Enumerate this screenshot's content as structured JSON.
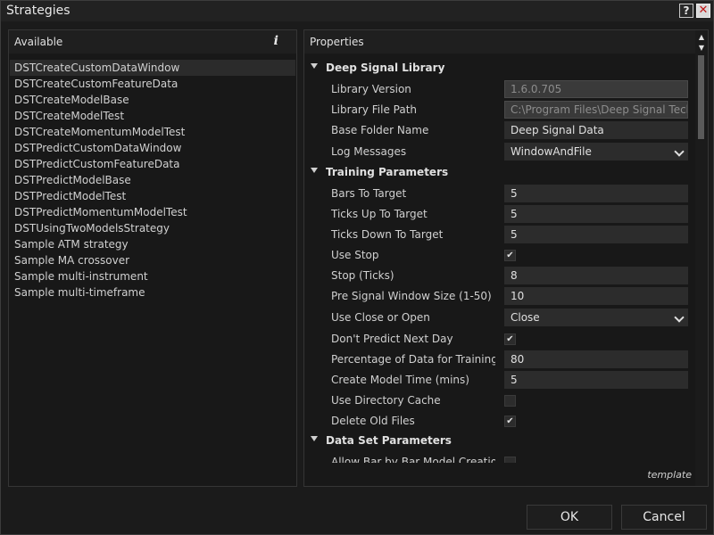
{
  "window": {
    "title": "Strategies",
    "help_label": "?",
    "close_label": "✕"
  },
  "available": {
    "header": "Available",
    "info_label": "i",
    "items": [
      "DSTCreateCustomDataWindow",
      "DSTCreateCustomFeatureData",
      "DSTCreateModelBase",
      "DSTCreateModelTest",
      "DSTCreateMomentumModelTest",
      "DSTPredictCustomDataWindow",
      "DSTPredictCustomFeatureData",
      "DSTPredictModelBase",
      "DSTPredictModelTest",
      "DSTPredictMomentumModelTest",
      "DSTUsingTwoModelsStrategy",
      "Sample ATM strategy",
      "Sample MA crossover",
      "Sample multi-instrument",
      "Sample multi-timeframe"
    ],
    "selected_index": 0
  },
  "properties": {
    "header": "Properties",
    "deep_signal_library": {
      "label": "Deep Signal Library",
      "library_version": {
        "label": "Library Version",
        "value": "1.6.0.705"
      },
      "library_file_path": {
        "label": "Library File Path",
        "value": "C:\\Program Files\\Deep Signal Tech\\D"
      },
      "base_folder_name": {
        "label": "Base Folder Name",
        "value": "Deep Signal Data"
      },
      "log_messages": {
        "label": "Log Messages",
        "value": "WindowAndFile"
      }
    },
    "training_parameters": {
      "label": "Training Parameters",
      "bars_to_target": {
        "label": "Bars To Target",
        "value": "5"
      },
      "ticks_up_to_target": {
        "label": "Ticks Up To Target",
        "value": "5"
      },
      "ticks_down_to_target": {
        "label": "Ticks Down To Target",
        "value": "5"
      },
      "use_stop": {
        "label": "Use Stop",
        "checked": true
      },
      "stop_ticks": {
        "label": "Stop (Ticks)",
        "value": "8"
      },
      "pre_signal_window_size": {
        "label": "Pre Signal Window Size (1-50)",
        "value": "10"
      },
      "use_close_or_open": {
        "label": "Use Close or Open",
        "value": "Close"
      },
      "dont_predict_next_day": {
        "label": "Don't Predict Next Day",
        "checked": true
      },
      "percentage_of_data": {
        "label": "Percentage of Data for Training (...",
        "value": "80"
      },
      "create_model_time": {
        "label": "Create Model Time (mins)",
        "value": "5"
      },
      "use_directory_cache": {
        "label": "Use Directory Cache",
        "checked": false
      },
      "delete_old_files": {
        "label": "Delete Old Files",
        "checked": true
      }
    },
    "data_set_parameters": {
      "label": "Data Set Parameters",
      "allow_bar_by_bar": {
        "label": "Allow Bar by Bar Model Creation",
        "checked": false
      }
    },
    "template_label": "template"
  },
  "buttons": {
    "ok": "OK",
    "cancel": "Cancel"
  },
  "glyphs": {
    "check": "✔",
    "scroll_up": "▲",
    "scroll_down": "▼"
  }
}
